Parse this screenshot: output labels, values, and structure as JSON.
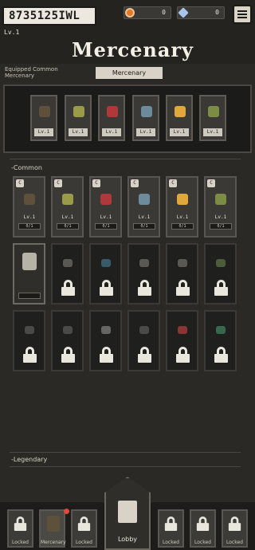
{
  "header": {
    "player_id": "8735125IWL",
    "level": "Lv.1",
    "coins": "0",
    "gems": "0"
  },
  "title": "Mercenary",
  "equipped_label": "Equipped Common Mercenary",
  "tab_label": "Mercenary",
  "equipped": [
    {
      "level": "Lv.1",
      "color": "#5f503c"
    },
    {
      "level": "Lv.1",
      "color": "#9a9a4a"
    },
    {
      "level": "Lv.1",
      "color": "#b0383a"
    },
    {
      "level": "Lv.1",
      "color": "#6c8c9c"
    },
    {
      "level": "Lv.1",
      "color": "#e0a83a"
    },
    {
      "level": "Lv.1",
      "color": "#7c8c44"
    }
  ],
  "sections": {
    "common": "-Common",
    "legendary": "-Legendary"
  },
  "common_cards": [
    {
      "grade": "C",
      "level": "Lv.1",
      "progress": "0/1",
      "color": "#5f503c"
    },
    {
      "grade": "C",
      "level": "Lv.1",
      "progress": "0/1",
      "color": "#9a9a4a"
    },
    {
      "grade": "C",
      "level": "Lv.1",
      "progress": "0/1",
      "color": "#b0383a"
    },
    {
      "grade": "C",
      "level": "Lv.1",
      "progress": "0/1",
      "color": "#6c8c9c"
    },
    {
      "grade": "C",
      "level": "Lv.1",
      "progress": "0/1",
      "color": "#e0a83a"
    },
    {
      "grade": "C",
      "level": "Lv.1",
      "progress": "0/1",
      "color": "#7c8c44"
    }
  ],
  "locked_sprites_row2": [
    "#d8d3c6",
    "#6a675f",
    "#3d6c7a",
    "#6a675f",
    "#6a675f",
    "#5b6b44"
  ],
  "locked_sprites_row3": [
    "#555",
    "#555",
    "#777",
    "#555",
    "#a83a3a",
    "#3d7a5a"
  ],
  "bottom_nav": {
    "left": [
      "Locked",
      "Mercenary",
      "Locked"
    ],
    "lobby": "Lobby",
    "right": [
      "Locked",
      "Locked",
      "Locked"
    ]
  },
  "colors": {
    "coin": "#e07a2a",
    "gem": "#a9c4e8"
  }
}
